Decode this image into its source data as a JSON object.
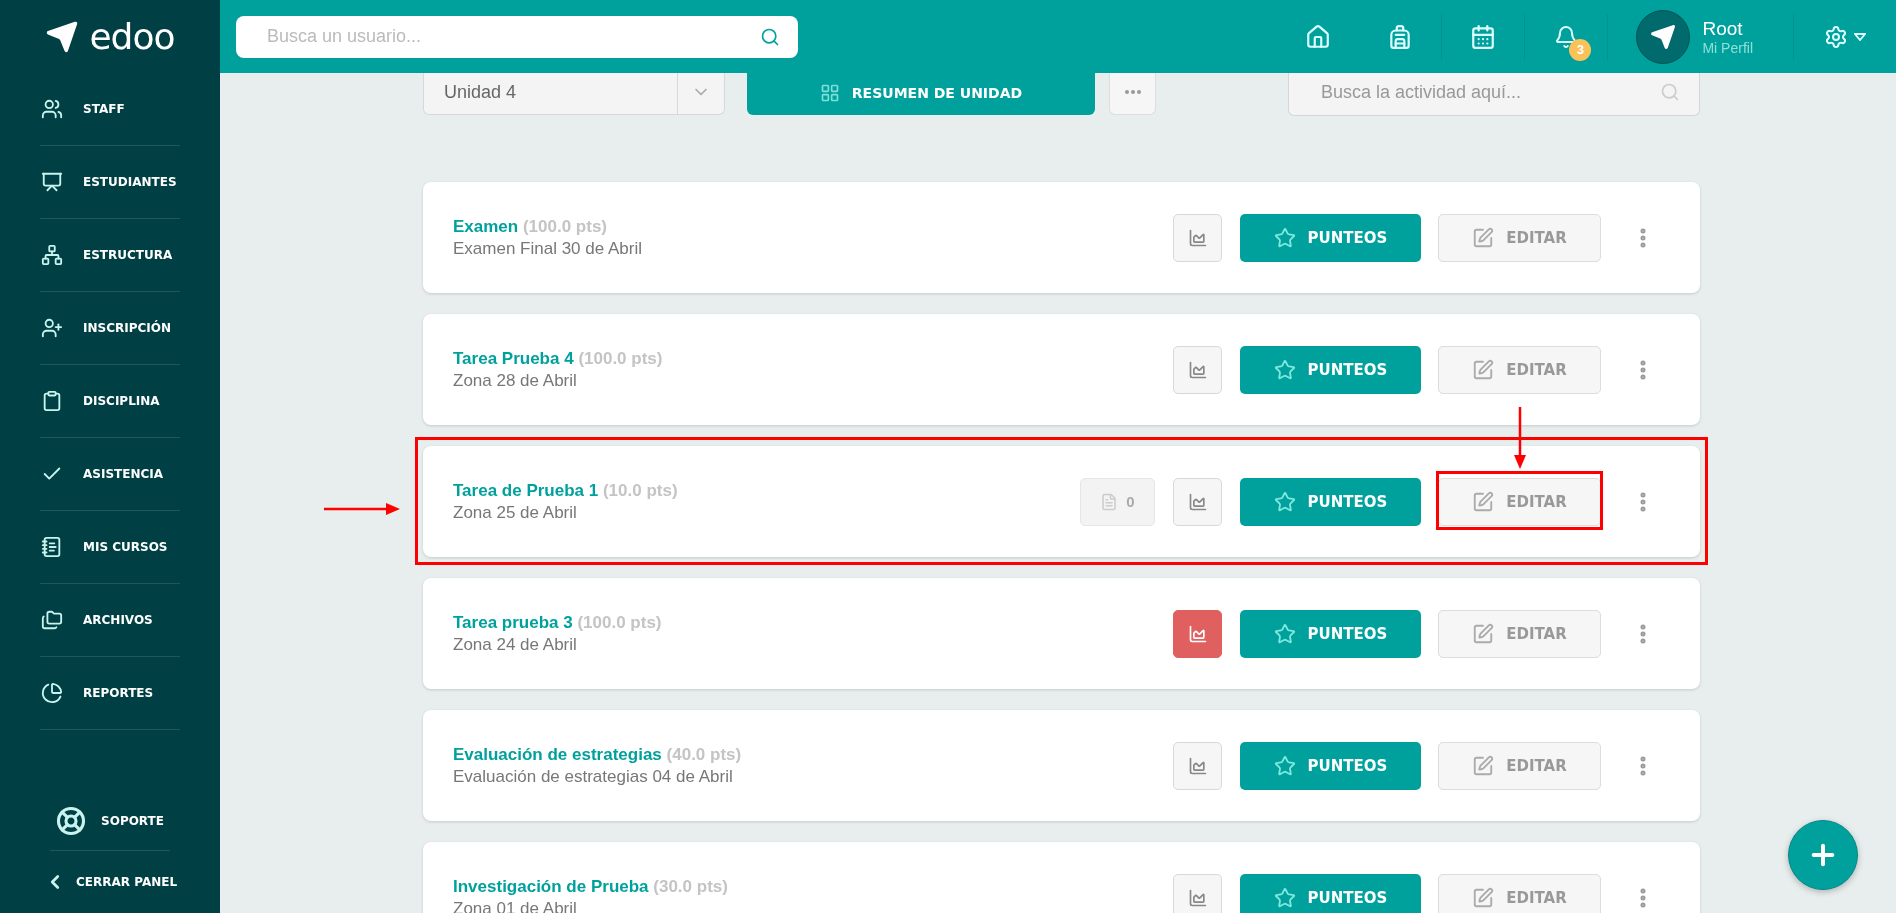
{
  "header": {
    "logo": "edoo",
    "search": {
      "placeholder": "Busca un usuario..."
    },
    "notifications": {
      "count": "3"
    },
    "user": {
      "name": "Root",
      "subtitle": "Mi Perfil"
    }
  },
  "sidebar": {
    "items": [
      {
        "label": "STAFF"
      },
      {
        "label": "ESTUDIANTES"
      },
      {
        "label": "ESTRUCTURA"
      },
      {
        "label": "INSCRIPCIÓN"
      },
      {
        "label": "DISCIPLINA"
      },
      {
        "label": "ASISTENCIA"
      },
      {
        "label": "MIS CURSOS"
      },
      {
        "label": "ARCHIVOS"
      },
      {
        "label": "REPORTES"
      }
    ],
    "support": "SOPORTE",
    "collapse": "CERRAR PANEL"
  },
  "toolbar": {
    "unit_select": {
      "value": "Unidad 4"
    },
    "summary_button": "RESUMEN DE UNIDAD",
    "activity_search": {
      "placeholder": "Busca la actividad aquí..."
    }
  },
  "activities": [
    {
      "title": "Examen",
      "points": "(100.0 pts)",
      "subtitle": "Examen Final 30 de Abril",
      "chart_alert": false,
      "score_label": "PUNTEOS",
      "edit_label": "EDITAR",
      "marked": false,
      "edit_marked": false
    },
    {
      "title": "Tarea Prueba 4",
      "points": "(100.0 pts)",
      "subtitle": "Zona 28 de Abril",
      "chart_alert": false,
      "score_label": "PUNTEOS",
      "edit_label": "EDITAR",
      "marked": false,
      "edit_marked": false
    },
    {
      "title": "Tarea de Prueba 1",
      "points": "(10.0 pts)",
      "subtitle": "Zona 25 de Abril",
      "attachments": "0",
      "chart_alert": false,
      "score_label": "PUNTEOS",
      "edit_label": "EDITAR",
      "marked": true,
      "edit_marked": true
    },
    {
      "title": "Tarea prueba 3",
      "points": "(100.0 pts)",
      "subtitle": "Zona 24 de Abril",
      "chart_alert": true,
      "score_label": "PUNTEOS",
      "edit_label": "EDITAR",
      "marked": false,
      "edit_marked": false
    },
    {
      "title": "Evaluación de estrategias",
      "points": "(40.0 pts)",
      "subtitle": "Evaluación de estrategias 04 de Abril",
      "chart_alert": false,
      "score_label": "PUNTEOS",
      "edit_label": "EDITAR",
      "marked": false,
      "edit_marked": false
    },
    {
      "title": "Investigación de Prueba",
      "points": "(30.0 pts)",
      "subtitle": "Zona 01 de Abril",
      "chart_alert": false,
      "score_label": "PUNTEOS",
      "edit_label": "EDITAR",
      "marked": false,
      "edit_marked": false
    }
  ]
}
